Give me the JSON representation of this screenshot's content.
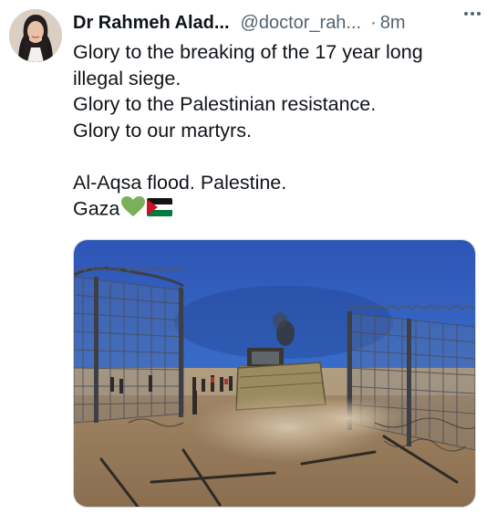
{
  "tweet": {
    "author_name": "Dr Rahmeh Alad...",
    "handle": "@doctor_rah...",
    "separator": "·",
    "time": "8m",
    "lines": [
      "Glory to the breaking of the 17 year long",
      "illegal siege.",
      "Glory to the Palestinian resistance.",
      "Glory to our martyrs.",
      "Al-Aqsa flood. Palestine.",
      "Gaza"
    ],
    "emojis": [
      "green-heart",
      "palestine-flag"
    ]
  },
  "colors": {
    "text": "#0f1419",
    "secondary": "#536471",
    "border": "#cfd9de",
    "heart": "#78b159",
    "flag_red": "#ce1126",
    "flag_green": "#007a3d"
  }
}
